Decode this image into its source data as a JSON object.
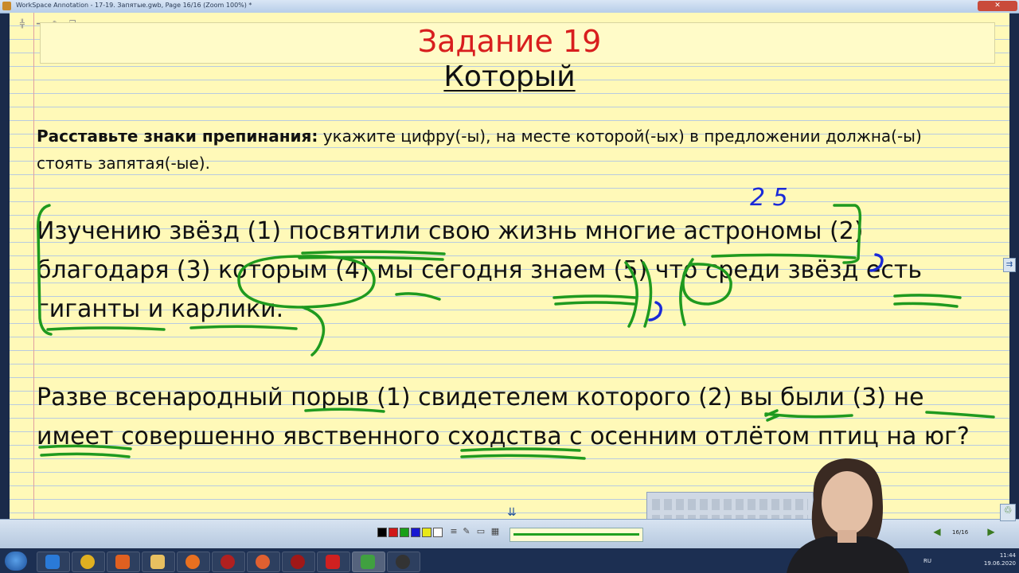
{
  "window": {
    "title": "WorkSpace Annotation - 17-19. Запятые.gwb, Page 16/16 (Zoom 100%) *",
    "close_label": "✕"
  },
  "page": {
    "task_title": "Задание 19",
    "heading": "Который",
    "instruction": {
      "bold": "Расставьте знаки препинания:",
      "rest": " укажите цифру(-ы), на месте которой(-ых) в предложении должна(-ы) стоять запятая(-ые)."
    },
    "sentence1": {
      "p1": "Изучению звёзд (1) ",
      "w_posvyatili": "посвятили",
      "p2": " свою жизнь многие ",
      "w_astronomy": "астрономы",
      "p3": " (2) благодаря (3) ",
      "w_kotorym": "которым",
      "p4": " (4) ",
      "w_my": "мы",
      "p5": " сегодня ",
      "w_znaem": "знаем",
      "p6": " (5) ",
      "w_chto": "что",
      "p7": " среди звёзд ",
      "w_est": "есть",
      "p8": " ",
      "w_giganty": "гиганты",
      "p9": " и ",
      "w_karliki": "карлики",
      "p10": "."
    },
    "sentence2": {
      "p1": "Разве всенародный ",
      "w_poryv": "порыв",
      "p2": " (1) свидетелем которого (2) ",
      "w_vy_byli": "вы были",
      "p3": " (3) ",
      "w_ne": "не",
      "p4": " ",
      "w_imeet": "имеет",
      "p5": " совершенно явственного ",
      "w_skhodstva": "сходства",
      "p6": " с осенним отлётом птиц на юг?"
    },
    "handwritten_answer": "2 5"
  },
  "toolbar": {
    "page_indicator": "16/16",
    "colors": [
      "#000000",
      "#d01818",
      "#18a018",
      "#1818d0",
      "#e8e818",
      "#ffffff"
    ]
  },
  "taskbar": {
    "lang": "RU",
    "time": "11:44",
    "date": "19.06.2020"
  },
  "ink": {
    "green": "#1f9a1f",
    "blue": "#1a2ad8"
  }
}
